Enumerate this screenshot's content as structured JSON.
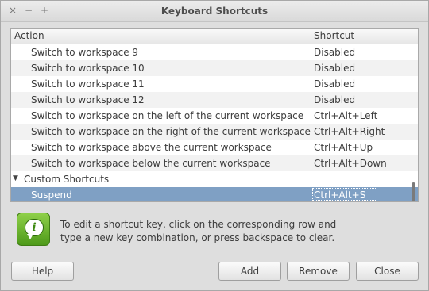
{
  "window": {
    "title": "Keyboard Shortcuts",
    "controls": {
      "close": "×",
      "minimize": "−",
      "maximize": "+"
    }
  },
  "list": {
    "columns": [
      "Action",
      "Shortcut"
    ],
    "rows": [
      {
        "action": "Switch to workspace 9",
        "shortcut": "Disabled"
      },
      {
        "action": "Switch to workspace 10",
        "shortcut": "Disabled"
      },
      {
        "action": "Switch to workspace 11",
        "shortcut": "Disabled"
      },
      {
        "action": "Switch to workspace 12",
        "shortcut": "Disabled"
      },
      {
        "action": "Switch to workspace on the left of the current workspace",
        "shortcut": "Ctrl+Alt+Left"
      },
      {
        "action": "Switch to workspace on the right of the current workspace",
        "shortcut": "Ctrl+Alt+Right"
      },
      {
        "action": "Switch to workspace above the current workspace",
        "shortcut": "Ctrl+Alt+Up"
      },
      {
        "action": "Switch to workspace below the current workspace",
        "shortcut": "Ctrl+Alt+Down"
      }
    ],
    "group": {
      "label": "Custom Shortcuts",
      "expander": "▼"
    },
    "selected": {
      "action": "Suspend",
      "shortcut": "Ctrl+Alt+S"
    }
  },
  "info": {
    "icon": "info-icon",
    "glyph": "i",
    "text": "To edit a shortcut key, click on the corresponding row and type a new key combination, or press backspace to clear."
  },
  "buttons": {
    "help": "Help",
    "add": "Add",
    "remove": "Remove",
    "close": "Close"
  }
}
